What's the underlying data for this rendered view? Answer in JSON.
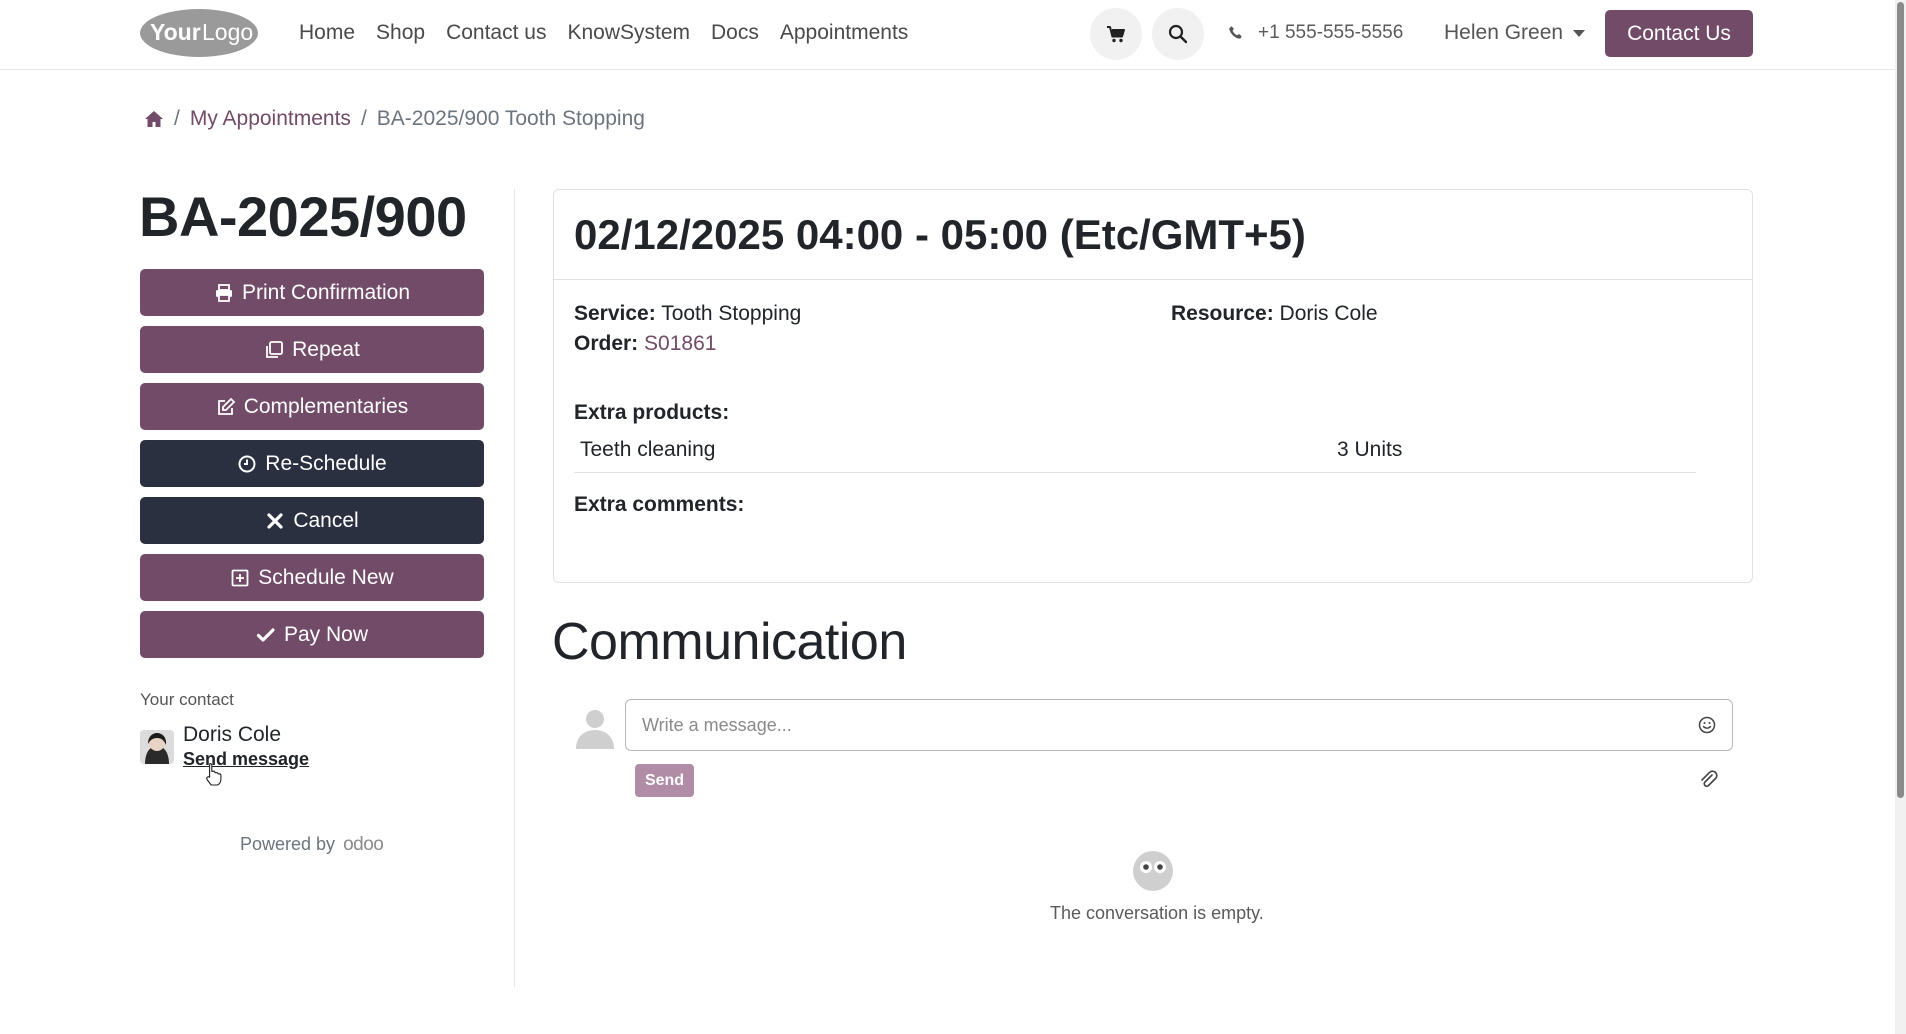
{
  "header": {
    "logo_text": "YourLogo",
    "nav": [
      "Home",
      "Shop",
      "Contact us",
      "KnowSystem",
      "Docs",
      "Appointments"
    ],
    "phone": "+1 555-555-5556",
    "user": "Helen Green",
    "contact_button": "Contact Us",
    "cart_icon": "cart-icon",
    "search_icon": "search-icon",
    "phone_icon": "phone-icon"
  },
  "breadcrumb": {
    "home_icon": "home-icon",
    "items": [
      "My Appointments",
      "BA-2025/900 Tooth Stopping"
    ]
  },
  "appointment": {
    "reference": "BA-2025/900",
    "actions": [
      {
        "label": "Print Confirmation",
        "icon": "print-icon",
        "style": "primary"
      },
      {
        "label": "Repeat",
        "icon": "copy-icon",
        "style": "primary"
      },
      {
        "label": "Complementaries",
        "icon": "edit-icon",
        "style": "primary"
      },
      {
        "label": "Re-Schedule",
        "icon": "clock-icon",
        "style": "dark"
      },
      {
        "label": "Cancel",
        "icon": "close-icon",
        "style": "dark"
      },
      {
        "label": "Schedule New",
        "icon": "plus-square-icon",
        "style": "primary"
      },
      {
        "label": "Pay Now",
        "icon": "check-icon",
        "style": "primary"
      }
    ],
    "contact": {
      "label": "Your contact",
      "name": "Doris Cole",
      "send_message": "Send message"
    },
    "powered_by": "Powered by",
    "powered_brand": "odoo",
    "datetime": "02/12/2025 04:00 - 05:00 (Etc/GMT+5)",
    "service_label": "Service:",
    "service": "Tooth Stopping",
    "order_label": "Order:",
    "order": "S01861",
    "resource_label": "Resource:",
    "resource": "Doris Cole",
    "extra_products_label": "Extra products:",
    "extra_products": [
      {
        "name": "Teeth cleaning",
        "qty": "3 Units"
      }
    ],
    "extra_comments_label": "Extra comments:"
  },
  "communication": {
    "title": "Communication",
    "placeholder": "Write a message...",
    "send": "Send",
    "empty": "The conversation is empty."
  },
  "colors": {
    "brand": "#714b67",
    "dark_button": "#2b3041",
    "send_disabled": "#b18ca7"
  }
}
